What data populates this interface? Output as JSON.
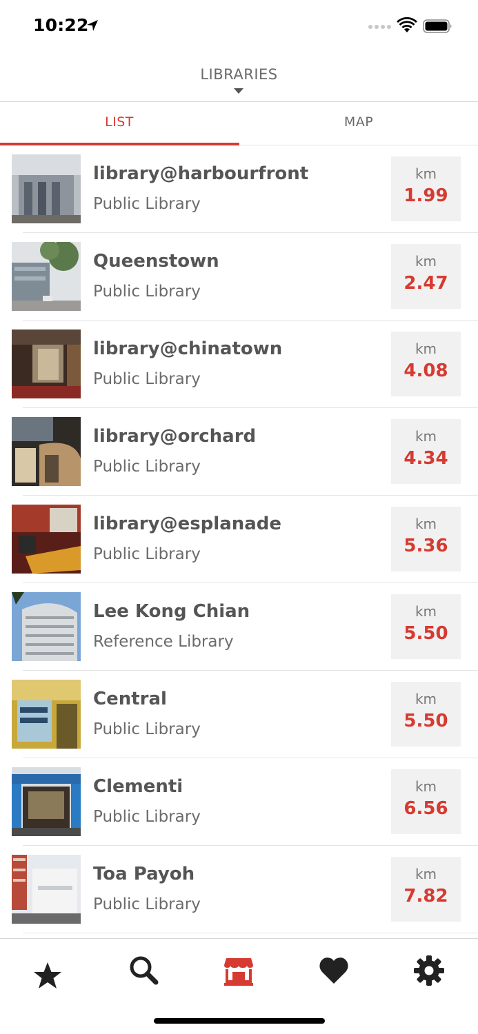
{
  "status": {
    "time": "10:22"
  },
  "header": {
    "title": "LIBRARIES"
  },
  "tabs": [
    {
      "label": "LIST",
      "active": true
    },
    {
      "label": "MAP",
      "active": false
    }
  ],
  "libraries": [
    {
      "name": "library@harbourfront",
      "type": "Public Library",
      "unit": "km",
      "distance": "1.99"
    },
    {
      "name": "Queenstown",
      "type": "Public Library",
      "unit": "km",
      "distance": "2.47"
    },
    {
      "name": "library@chinatown",
      "type": "Public Library",
      "unit": "km",
      "distance": "4.08"
    },
    {
      "name": "library@orchard",
      "type": "Public Library",
      "unit": "km",
      "distance": "4.34"
    },
    {
      "name": "library@esplanade",
      "type": "Public Library",
      "unit": "km",
      "distance": "5.36"
    },
    {
      "name": "Lee Kong Chian",
      "type": "Reference Library",
      "unit": "km",
      "distance": "5.50"
    },
    {
      "name": "Central",
      "type": "Public Library",
      "unit": "km",
      "distance": "5.50"
    },
    {
      "name": "Clementi",
      "type": "Public Library",
      "unit": "km",
      "distance": "6.56"
    },
    {
      "name": "Toa Payoh",
      "type": "Public Library",
      "unit": "km",
      "distance": "7.82"
    }
  ],
  "tab_bar": [
    {
      "icon": "star-icon",
      "active": false
    },
    {
      "icon": "search-icon",
      "active": false
    },
    {
      "icon": "store-icon",
      "active": true
    },
    {
      "icon": "heart-icon",
      "active": false
    },
    {
      "icon": "gear-icon",
      "active": false
    }
  ],
  "colors": {
    "accent": "#d63a31",
    "text": "#555555",
    "distance_bg": "#f1f1f1"
  }
}
